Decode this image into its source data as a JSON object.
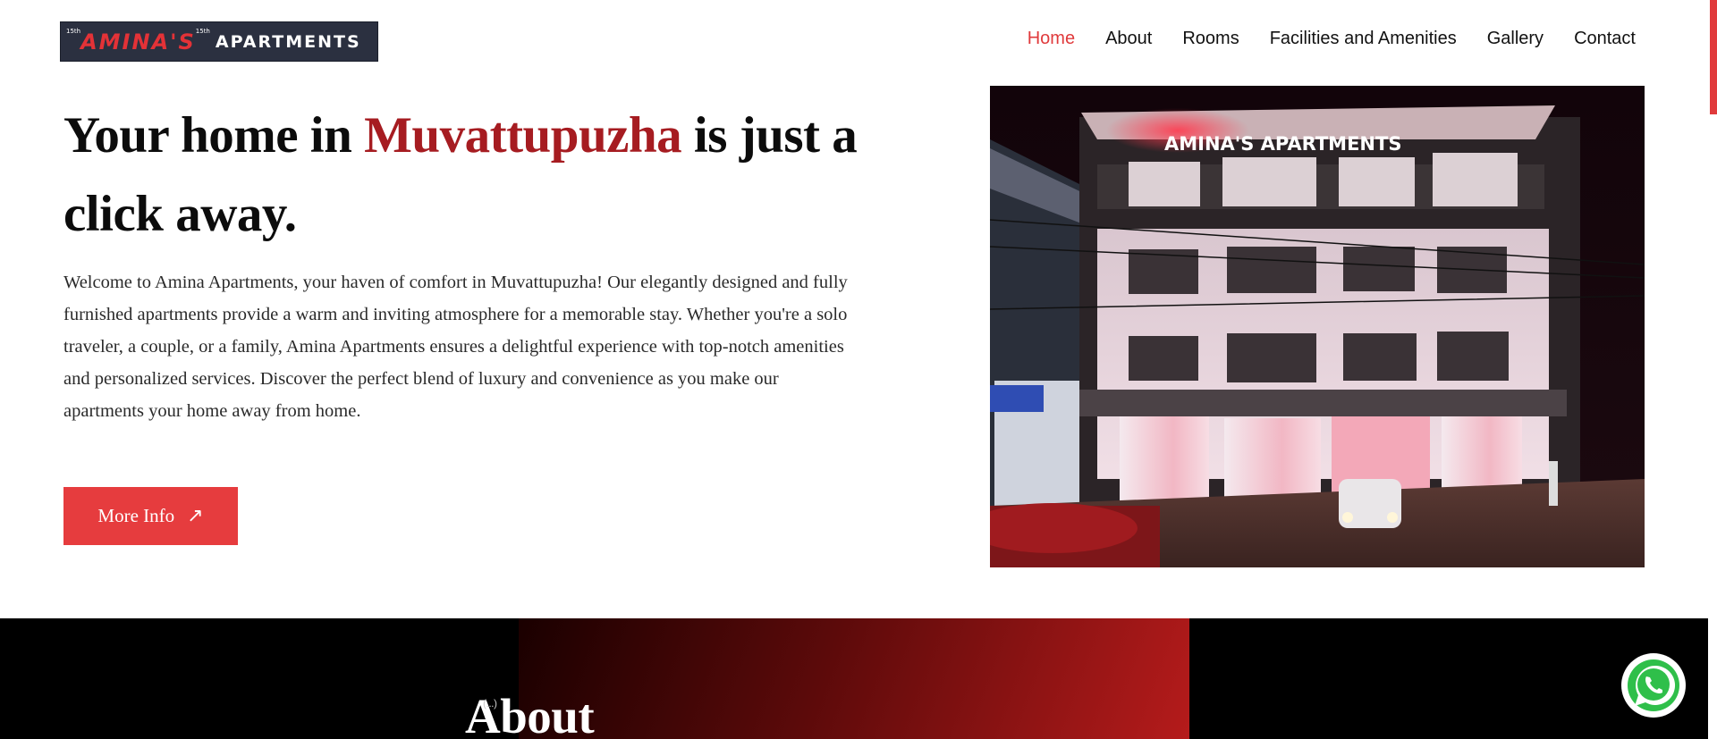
{
  "brand": {
    "logo_mark": "15th",
    "logo_word1": "AMINA'S",
    "logo_word2": "APARTMENTS"
  },
  "nav": {
    "items": [
      {
        "label": "Home",
        "active": true
      },
      {
        "label": "About",
        "active": false
      },
      {
        "label": "Rooms",
        "active": false
      },
      {
        "label": "Facilities and Amenities",
        "active": false
      },
      {
        "label": "Gallery",
        "active": false
      },
      {
        "label": "Contact",
        "active": false
      }
    ]
  },
  "hero": {
    "title_before": "Your home in ",
    "title_highlight": "Muvattupuzha",
    "title_after": " is just a click away.",
    "description": "Welcome to Amina Apartments, your haven of comfort in Muvattupuzha! Our elegantly designed and fully furnished apartments provide a warm and inviting atmosphere for a memorable stay. Whether you're a solo traveler, a couple, or a family, Amina Apartments ensures a delightful experience with top-notch amenities and personalized services. Discover the perfect blend of luxury and convenience as you make our apartments your home away from home.",
    "button_label": "More Info",
    "button_icon": "arrow-up-right-icon",
    "image_sign": "AMINA'S APARTMENTS"
  },
  "about": {
    "title": "About",
    "tag": "(...)"
  },
  "widgets": {
    "whatsapp_icon": "whatsapp-icon"
  },
  "colors": {
    "accent": "#e03a3c",
    "highlight": "#a61c21",
    "button": "#e63c3e",
    "logo_bg": "#2b3040"
  }
}
